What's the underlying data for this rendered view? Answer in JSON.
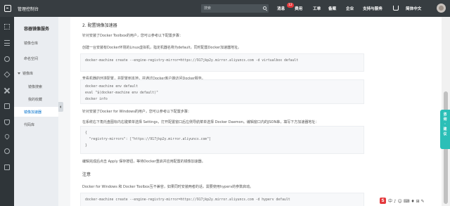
{
  "topbar": {
    "console_title": "管理控制台",
    "search_placeholder": "搜索",
    "nav": {
      "messages": "消息",
      "messages_count": "12",
      "billing": "费用",
      "ticket": "工单",
      "icp": "备案",
      "enterprise": "企业",
      "support": "支持与服务",
      "language": "简体中文"
    }
  },
  "sidebar": {
    "title": "容器镜像服务",
    "items": [
      {
        "label": "镜像仓库"
      },
      {
        "label": "命名空间"
      },
      {
        "label": "镜像库"
      },
      {
        "label": "镜像搜索"
      },
      {
        "label": "我的收藏"
      },
      {
        "label": "镜像加速器"
      },
      {
        "label": "代码库"
      }
    ]
  },
  "content": {
    "section2_heading": "2. 配置镜像加速器",
    "toolbox_intro": "针对安装了Docker Toolbox的用户，您可以参考以下配置步骤：",
    "toolbox_step1": "创建一台安装有Docker环境的Linux虚拟机，指定机器名称为default，同时配置Docker加速器地址。",
    "code1": "docker-machine create --engine-registry-mirror=https://917jkp2y.mirror.aliyuncs.com -d virtualbox default",
    "toolbox_step2": "查看机器的环境配置，并配置到本地，并通过Docker客户端访问Docker服务。",
    "code2_lines": [
      "docker-machine env default",
      "eval \"$(docker-machine env default)\"",
      "docker info"
    ],
    "windows_intro": "针对安装了Docker for Windows的用户，您可以参考以下配置步骤：",
    "windows_step": "在系统右下角托盘图标内右键菜单选择 Settings，打开配置窗口后左侧导航菜单选择 Docker Daemon。编辑窗口内的JSON串，填写下方加速器地址：",
    "code3_lines": [
      "{",
      "  \"registry-mirrors\": [\"https://917jkp2y.mirror.aliyuncs.com\"]",
      "}"
    ],
    "windows_after": "编辑完成后点击 Apply 保存按钮，等待Docker重启并应用配置的镜像加速器。",
    "note_heading": "注意",
    "note_text": "Docker for Windows 和 Docker Toolbox互不兼容，如果同时安装两者的话，需要使用hyperv的参数启动。",
    "code4": "docker-machine create --engine-registry-mirror=https://917jkp2y.mirror.aliyuncs.com -d hyperv default"
  },
  "float_tab": [
    "咨",
    "询",
    "·",
    "建",
    "议"
  ],
  "ime": {
    "logo": "S",
    "glyphs": "中 ♪ ☺ ⌨ ♦ ⊞ ✎"
  }
}
